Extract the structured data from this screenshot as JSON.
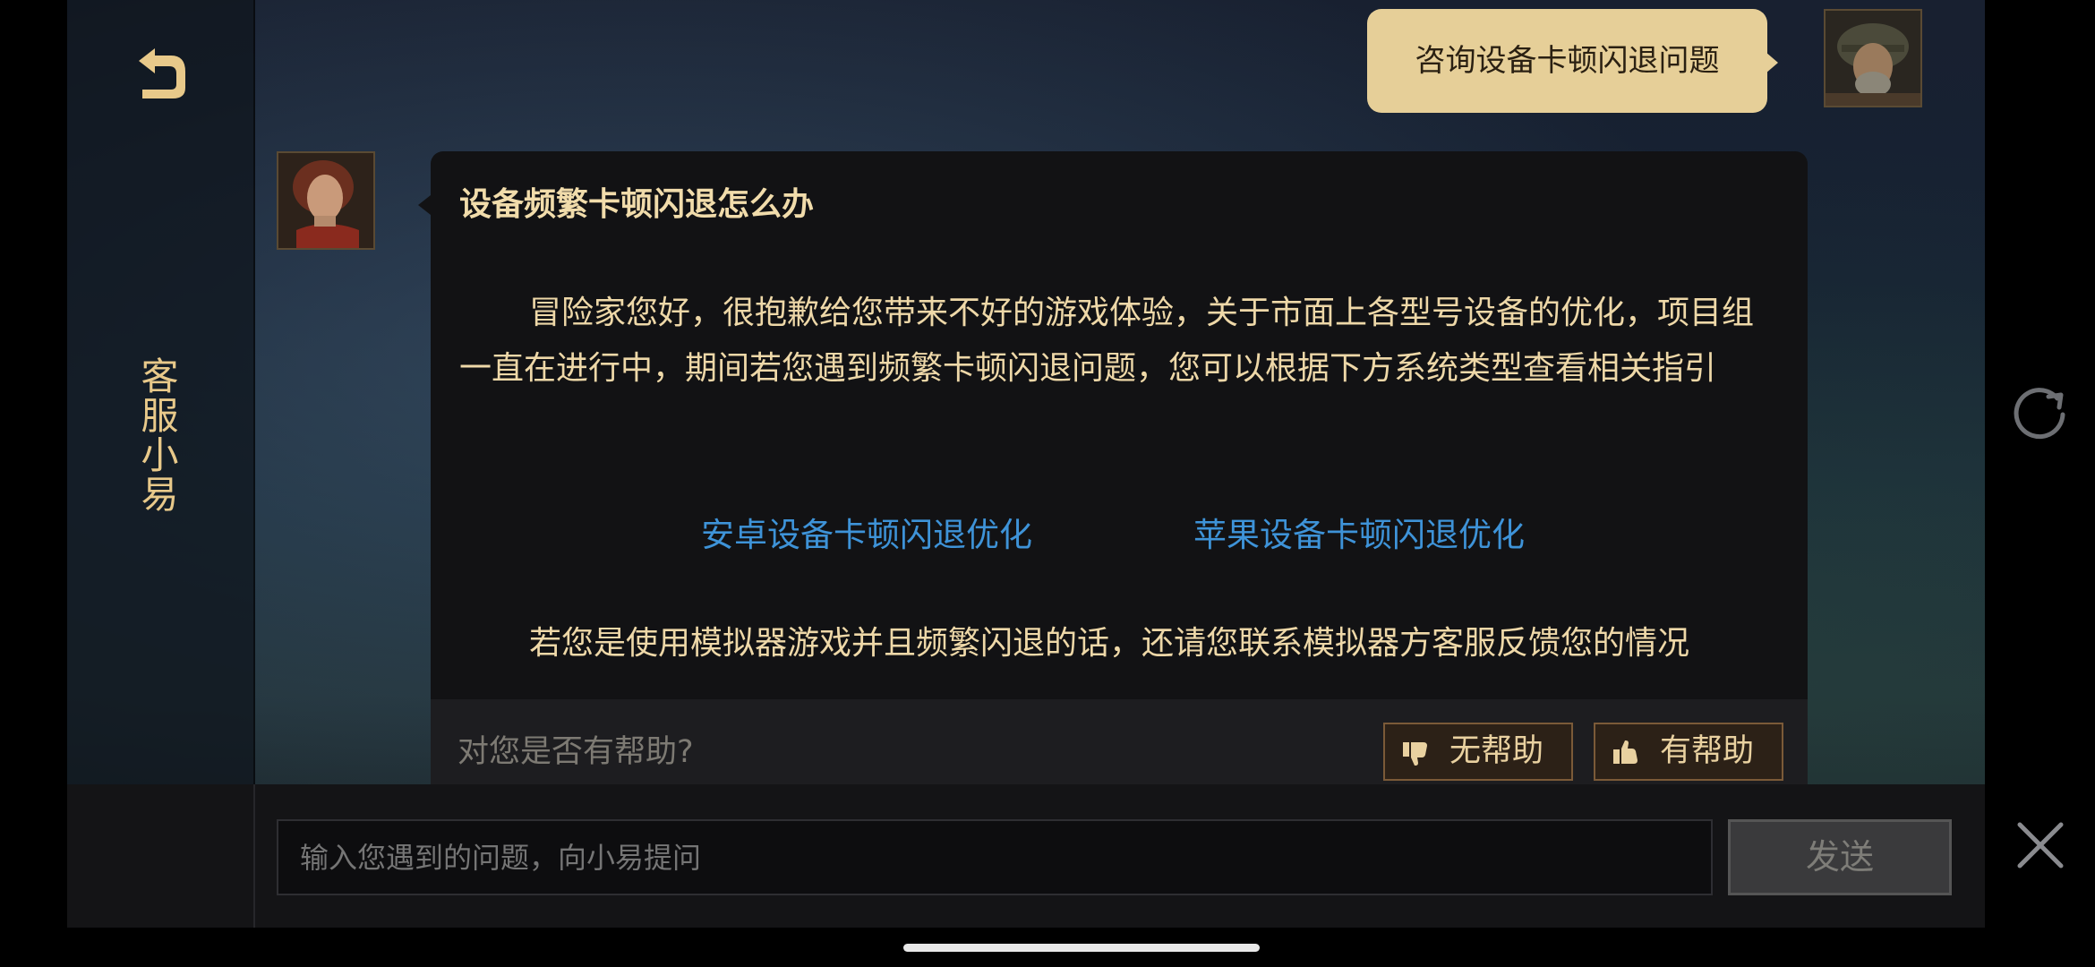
{
  "sidebar": {
    "title": "客服小易",
    "back_icon": "back-arrow-icon"
  },
  "conversation": {
    "user_message": "咨询设备卡顿闪退问题",
    "bot_card": {
      "title": "设备频繁卡顿闪退怎么办",
      "paragraph": "冒险家您好，很抱歉给您带来不好的游戏体验，关于市面上各型号设备的优化，项目组一直在进行中，期间若您遇到频繁卡顿闪退问题，您可以根据下方系统类型查看相关指引",
      "links": [
        "安卓设备卡顿闪退优化",
        "苹果设备卡顿闪退优化"
      ],
      "paragraph2": "若您是使用模拟器游戏并且频繁闪退的话，还请您联系模拟器方客服反馈您的情况"
    },
    "feedback": {
      "question": "对您是否有帮助?",
      "not_helpful": "无帮助",
      "helpful": "有帮助"
    }
  },
  "input": {
    "placeholder": "输入您遇到的问题，向小易提问",
    "send_label": "发送"
  },
  "colors": {
    "accent_gold": "#e6cf98",
    "link_blue": "#3e93d8",
    "card_bg": "#121214"
  }
}
